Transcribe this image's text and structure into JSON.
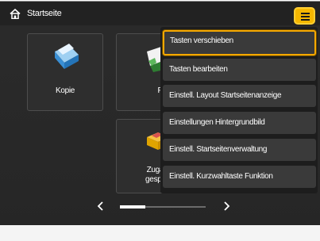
{
  "header": {
    "title": "Startseite",
    "home_icon": "home-icon",
    "menu_icon": "hamburger-menu-icon",
    "menu_color": "#f5b700"
  },
  "tiles": [
    {
      "label": "Kopie",
      "icon": "copy-icon"
    },
    {
      "label": "Fa",
      "icon": "fax-icon"
    },
    {
      "label": "Zugan\ngesp.D",
      "icon": "stored-files-icon"
    }
  ],
  "menu": {
    "items": [
      {
        "label": "Tasten verschieben",
        "selected": true
      },
      {
        "label": "Tasten bearbeiten",
        "selected": false
      },
      {
        "label": "Einstell. Layout Startseitenanzeige",
        "selected": false
      },
      {
        "label": "Einstellungen Hintergrundbild",
        "selected": false
      },
      {
        "label": "Einstell. Startseitenverwaltung",
        "selected": false
      },
      {
        "label": "Einstell. Kurzwahltaste Funktion",
        "selected": false
      }
    ]
  },
  "pager": {
    "prev_icon": "chevron-left-icon",
    "next_icon": "chevron-right-icon",
    "position_fraction": 0.3
  }
}
